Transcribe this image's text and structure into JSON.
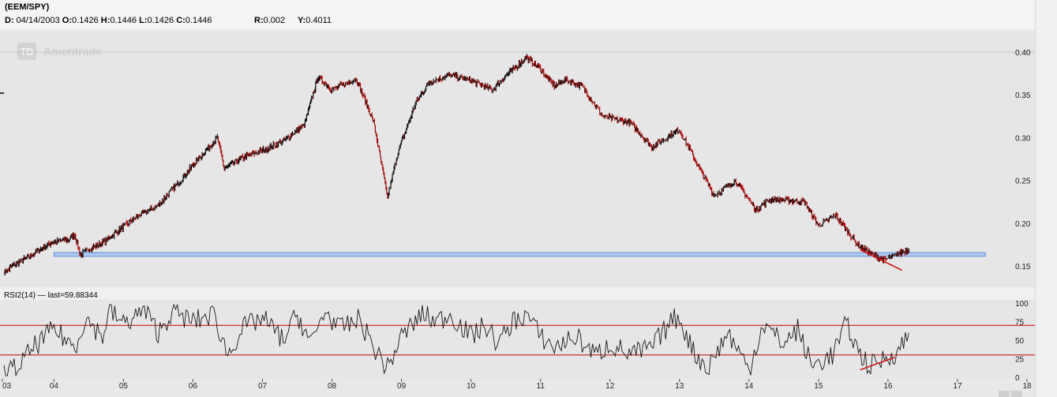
{
  "header": {
    "symbol": "(EEM/SPY)",
    "date_label": "D:",
    "date_value": "04/14/2003",
    "open_label": "O:",
    "open_value": "0.1426",
    "high_label": "H:",
    "high_value": "0.1446",
    "low_label": "L:",
    "low_value": "0.1426",
    "close_label": "C:",
    "close_value": "0.1446",
    "r_label": "R:",
    "r_value": "0.002",
    "y_label": "Y:",
    "y_value": "0.4011"
  },
  "watermark": {
    "logo_letters": "TD",
    "brand": "Ameritrade"
  },
  "rsi_header": {
    "label": "RSI2(14) — last=59.88344"
  },
  "colors": {
    "background": "#e6e6e6",
    "up": "#000000",
    "down": "#c00000",
    "support_band": "#a8c4f0",
    "support_border": "#5b8fe0",
    "trend_line": "#d01010",
    "rsi_line": "#1a1a1a",
    "rsi_levels": "#c00000"
  },
  "chart_data": [
    {
      "type": "line",
      "title": "(EEM/SPY)",
      "x_tick_labels": [
        "03",
        "04",
        "05",
        "06",
        "07",
        "08",
        "09",
        "10",
        "11",
        "12",
        "13",
        "14",
        "15",
        "16",
        "17",
        "18"
      ],
      "x_range": [
        2003.28,
        2018.0
      ],
      "y_tick_labels": [
        "0.40",
        "0.35",
        "0.30",
        "0.25",
        "0.20",
        "0.15"
      ],
      "ylim": [
        0.128,
        0.41
      ],
      "grid": false,
      "series": [
        {
          "values_xy": [
            [
              2003.28,
              0.1426
            ],
            [
              2003.45,
              0.152
            ],
            [
              2003.7,
              0.164
            ],
            [
              2003.95,
              0.177
            ],
            [
              2004.2,
              0.181
            ],
            [
              2004.3,
              0.186
            ],
            [
              2004.38,
              0.163
            ],
            [
              2004.5,
              0.17
            ],
            [
              2004.7,
              0.177
            ],
            [
              2004.95,
              0.193
            ],
            [
              2005.2,
              0.208
            ],
            [
              2005.5,
              0.221
            ],
            [
              2005.8,
              0.248
            ],
            [
              2006.0,
              0.268
            ],
            [
              2006.35,
              0.3
            ],
            [
              2006.45,
              0.264
            ],
            [
              2006.7,
              0.276
            ],
            [
              2007.0,
              0.285
            ],
            [
              2007.3,
              0.296
            ],
            [
              2007.6,
              0.315
            ],
            [
              2007.8,
              0.371
            ],
            [
              2008.0,
              0.356
            ],
            [
              2008.35,
              0.369
            ],
            [
              2008.6,
              0.318
            ],
            [
              2008.8,
              0.23
            ],
            [
              2008.95,
              0.283
            ],
            [
              2009.2,
              0.34
            ],
            [
              2009.4,
              0.365
            ],
            [
              2009.7,
              0.373
            ],
            [
              2010.0,
              0.367
            ],
            [
              2010.3,
              0.356
            ],
            [
              2010.5,
              0.372
            ],
            [
              2010.8,
              0.394
            ],
            [
              2011.0,
              0.38
            ],
            [
              2011.2,
              0.36
            ],
            [
              2011.35,
              0.368
            ],
            [
              2011.6,
              0.36
            ],
            [
              2011.9,
              0.325
            ],
            [
              2012.3,
              0.317
            ],
            [
              2012.6,
              0.289
            ],
            [
              2013.0,
              0.309
            ],
            [
              2013.25,
              0.27
            ],
            [
              2013.5,
              0.232
            ],
            [
              2013.8,
              0.25
            ],
            [
              2014.1,
              0.216
            ],
            [
              2014.3,
              0.228
            ],
            [
              2014.8,
              0.225
            ],
            [
              2015.0,
              0.197
            ],
            [
              2015.25,
              0.209
            ],
            [
              2015.55,
              0.176
            ],
            [
              2015.75,
              0.165
            ],
            [
              2015.95,
              0.157
            ],
            [
              2016.1,
              0.162
            ],
            [
              2016.3,
              0.17
            ]
          ]
        }
      ],
      "annotations": [
        {
          "type": "horizontal-band",
          "y_range": [
            0.1613,
            0.1657
          ],
          "x_range": [
            2004.0,
            2017.4
          ]
        },
        {
          "type": "trend-line",
          "from": [
            2015.6,
            0.169
          ],
          "to": [
            2016.2,
            0.145
          ]
        }
      ]
    },
    {
      "type": "line",
      "title": "RSI2(14) — last=59.88344",
      "x_tick_labels": [
        "03",
        "04",
        "05",
        "06",
        "07",
        "08",
        "09",
        "10",
        "11",
        "12",
        "13",
        "14",
        "15",
        "16",
        "17",
        "18"
      ],
      "x_range": [
        2003.28,
        2018.0
      ],
      "y_tick_labels": [
        "100",
        "75",
        "50",
        "25",
        "0"
      ],
      "ylim": [
        0,
        100
      ],
      "reference_lines": [
        70,
        30
      ],
      "series": [
        {
          "name": "RSI2(14)",
          "last": 59.88344,
          "values_xy": [
            [
              2003.28,
              5
            ],
            [
              2003.5,
              15
            ],
            [
              2003.7,
              40
            ],
            [
              2004.0,
              65
            ],
            [
              2004.3,
              40
            ],
            [
              2004.45,
              80
            ],
            [
              2004.7,
              55
            ],
            [
              2004.8,
              90
            ],
            [
              2005.0,
              72
            ],
            [
              2005.3,
              90
            ],
            [
              2005.5,
              60
            ],
            [
              2005.7,
              88
            ],
            [
              2006.0,
              75
            ],
            [
              2006.3,
              85
            ],
            [
              2006.5,
              30
            ],
            [
              2006.7,
              65
            ],
            [
              2007.0,
              80
            ],
            [
              2007.3,
              50
            ],
            [
              2007.5,
              85
            ],
            [
              2007.7,
              45
            ],
            [
              2007.9,
              90
            ],
            [
              2008.1,
              65
            ],
            [
              2008.4,
              78
            ],
            [
              2008.6,
              40
            ],
            [
              2008.8,
              12
            ],
            [
              2009.0,
              55
            ],
            [
              2009.3,
              85
            ],
            [
              2009.5,
              75
            ],
            [
              2009.7,
              85
            ],
            [
              2010.0,
              55
            ],
            [
              2010.2,
              70
            ],
            [
              2010.4,
              45
            ],
            [
              2010.6,
              75
            ],
            [
              2010.8,
              85
            ],
            [
              2011.0,
              55
            ],
            [
              2011.2,
              40
            ],
            [
              2011.5,
              55
            ],
            [
              2011.8,
              30
            ],
            [
              2012.0,
              45
            ],
            [
              2012.3,
              30
            ],
            [
              2012.6,
              40
            ],
            [
              2012.9,
              78
            ],
            [
              2013.0,
              80
            ],
            [
              2013.2,
              35
            ],
            [
              2013.4,
              12
            ],
            [
              2013.7,
              60
            ],
            [
              2014.0,
              10
            ],
            [
              2014.2,
              72
            ],
            [
              2014.5,
              45
            ],
            [
              2014.7,
              65
            ],
            [
              2014.9,
              15
            ],
            [
              2015.2,
              30
            ],
            [
              2015.4,
              72
            ],
            [
              2015.6,
              30
            ],
            [
              2015.75,
              15
            ],
            [
              2016.0,
              28
            ],
            [
              2016.15,
              35
            ],
            [
              2016.3,
              60
            ]
          ]
        }
      ],
      "annotations": [
        {
          "type": "trend-line",
          "from": [
            2015.6,
            10
          ],
          "to": [
            2016.1,
            27
          ]
        }
      ]
    }
  ]
}
